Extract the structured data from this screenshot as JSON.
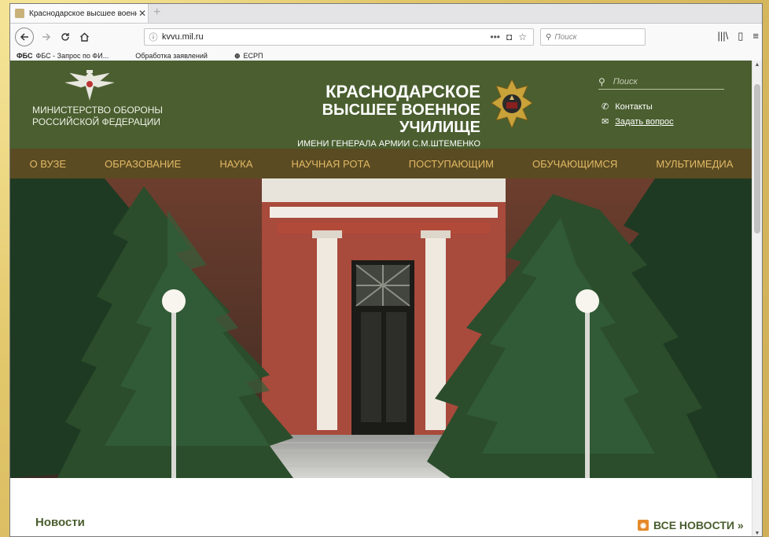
{
  "browser": {
    "tab_title": "Краснодарское высшее военн",
    "tab_close": "✕",
    "new_tab": "+",
    "url": "kvvu.mil.ru",
    "url_actions": "•••",
    "search_placeholder": "Поиск",
    "bookmarks": [
      {
        "icon": "ФБС",
        "label": "ФБС - Запрос по ФИ..."
      },
      {
        "icon": "",
        "label": "Обработка заявлений"
      },
      {
        "icon": "⊕",
        "label": "ЕСРП"
      }
    ]
  },
  "site": {
    "ministry_line1": "МИНИСТЕРСТВО ОБОРОНЫ",
    "ministry_line2": "РОССИЙСКОЙ ФЕДЕРАЦИИ",
    "college_line1": "КРАСНОДАРСКОЕ",
    "college_line2": "ВЫСШЕЕ ВОЕННОЕ УЧИЛИЩЕ",
    "college_line3": "ИМЕНИ ГЕНЕРАЛА АРМИИ С.М.ШТЕМЕНКО",
    "search_placeholder": "Поиск",
    "contacts_label": "Контакты",
    "ask_label": "Задать вопрос",
    "menu": [
      "О ВУЗЕ",
      "ОБРАЗОВАНИЕ",
      "НАУКА",
      "НАУЧНАЯ РОТА",
      "ПОСТУПАЮЩИМ",
      "ОБУЧАЮЩИМСЯ",
      "МУЛЬТИМЕДИА"
    ],
    "news_title": "Новости",
    "all_news": "ВСЕ НОВОСТИ »"
  },
  "colors": {
    "header_green": "#4a5e2f",
    "menu_brown": "#5a4b22",
    "menu_text": "#e2b965"
  }
}
